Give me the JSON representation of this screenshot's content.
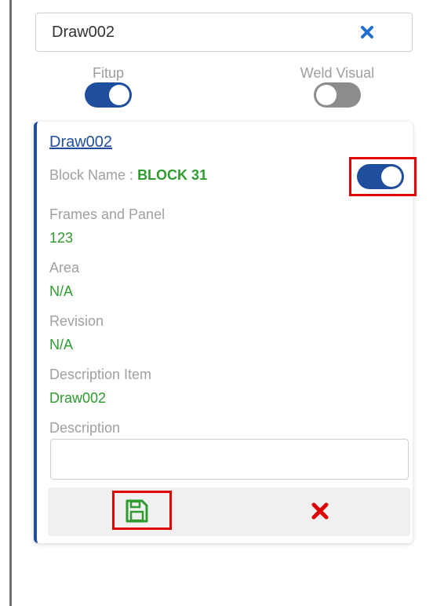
{
  "search": {
    "value": "Draw002",
    "clear_icon": "close-icon",
    "clear_color": "#1f6fd0"
  },
  "modes": {
    "fitup": {
      "label": "Fitup",
      "enabled": true
    },
    "weld_visual": {
      "label": "Weld Visual",
      "enabled": false
    }
  },
  "card": {
    "title": "Draw002",
    "block_name_label": "Block Name :",
    "block_name_value": "BLOCK 31",
    "toggle_enabled": true,
    "fields": [
      {
        "label": "Frames and Panel",
        "value": "123"
      },
      {
        "label": "Area",
        "value": "N/A"
      },
      {
        "label": "Revision",
        "value": "N/A"
      },
      {
        "label": "Description Item",
        "value": "Draw002"
      }
    ],
    "description_label": "Description",
    "description_value": "",
    "save_icon": "floppy-disk-icon",
    "cancel_icon": "close-icon"
  },
  "colors": {
    "accent": "#1f4e9e",
    "value_green": "#2e9b2e",
    "label_gray": "#a0a0a0",
    "save_green": "#2e9b2e",
    "cancel_red": "#e00000",
    "highlight_red": "#e00000"
  }
}
